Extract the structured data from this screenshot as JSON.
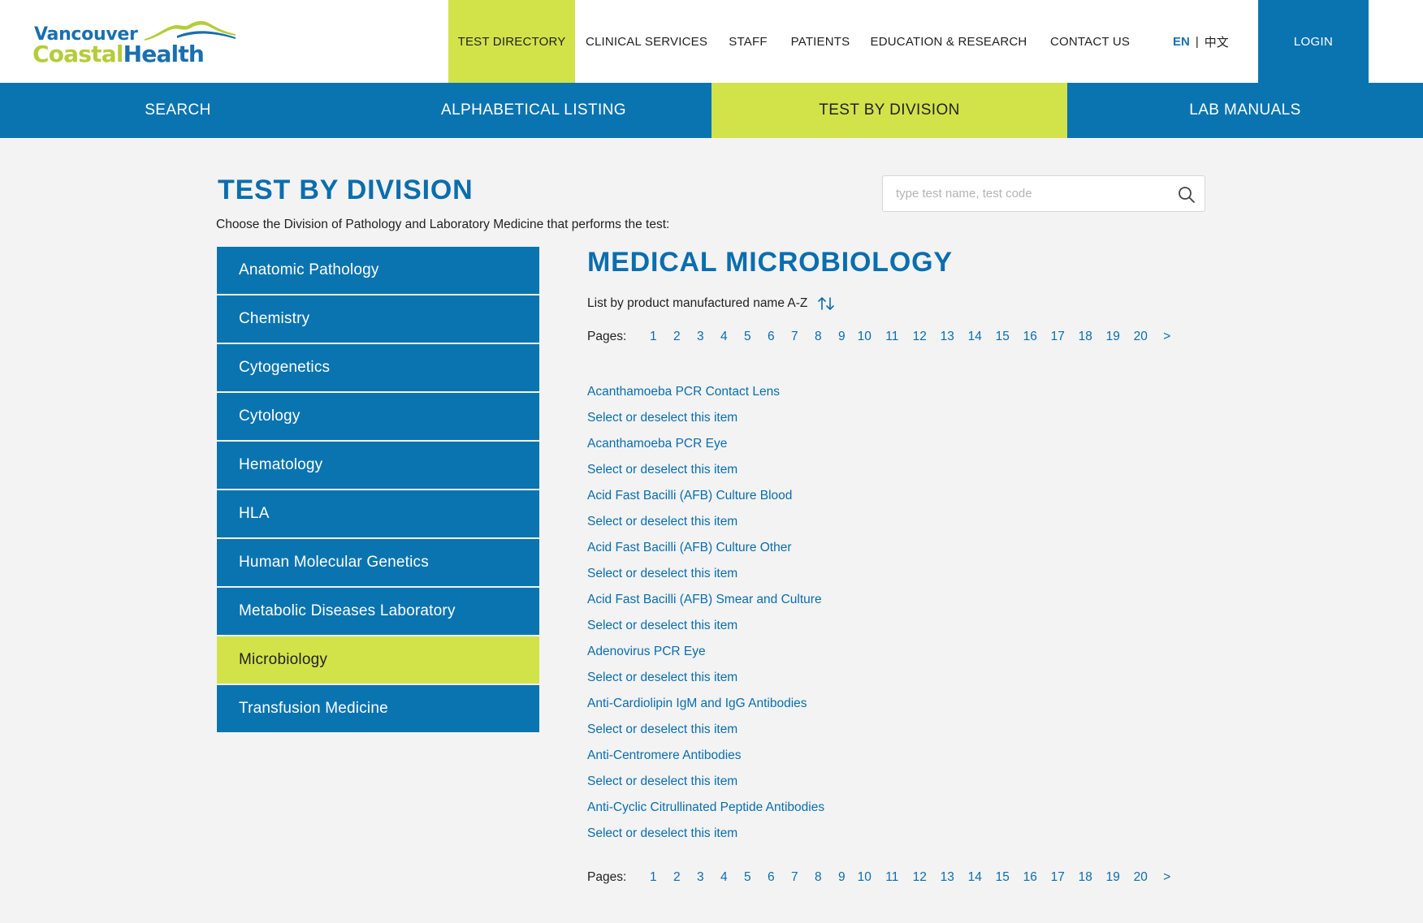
{
  "brand": {
    "line1": "Vancouver",
    "line2_a": "Coastal",
    "line2_b": "Health",
    "colors": {
      "blue": "#0a74b0",
      "lime": "#d2e34a",
      "background": "#f3f3f3"
    }
  },
  "top_nav": {
    "items": [
      {
        "label": "TEST DIRECTORY",
        "active": true
      },
      {
        "label": "CLINICAL SERVICES",
        "active": false
      },
      {
        "label": "STAFF",
        "active": false
      },
      {
        "label": "PATIENTS",
        "active": false
      },
      {
        "label": "EDUCATION & RESEARCH",
        "active": false
      },
      {
        "label": "CONTACT US",
        "active": false
      }
    ],
    "lang_en": "EN",
    "lang_sep": "|",
    "lang_zh": "中文",
    "login": "LOGIN"
  },
  "sub_nav": {
    "items": [
      {
        "label": "SEARCH",
        "active": false
      },
      {
        "label": "ALPHABETICAL LISTING",
        "active": false
      },
      {
        "label": "TEST BY DIVISION",
        "active": true
      },
      {
        "label": "LAB MANUALS",
        "active": false
      }
    ]
  },
  "page": {
    "title": "TEST BY DIVISION",
    "subtitle": "Choose the Division of Pathology and Laboratory Medicine that performs the test:",
    "search_placeholder": "type test name, test code",
    "search_icon": "magnifier-icon"
  },
  "divisions": [
    {
      "label": "Anatomic Pathology",
      "active": false
    },
    {
      "label": "Chemistry",
      "active": false
    },
    {
      "label": "Cytogenetics",
      "active": false
    },
    {
      "label": "Cytology",
      "active": false
    },
    {
      "label": "Hematology",
      "active": false
    },
    {
      "label": "HLA",
      "active": false
    },
    {
      "label": "Human Molecular Genetics",
      "active": false
    },
    {
      "label": "Metabolic Diseases Laboratory",
      "active": false
    },
    {
      "label": "Microbiology",
      "active": true
    },
    {
      "label": "Transfusion Medicine",
      "active": false
    }
  ],
  "content": {
    "section_title": "MEDICAL MICROBIOLOGY",
    "sort_label": "List by product manufactured name A-Z",
    "sort_icon": "sort-arrows-icon",
    "pages_label": "Pages:",
    "pages": [
      "1",
      "2",
      "3",
      "4",
      "5",
      "6",
      "7",
      "8",
      "9",
      "10",
      "11",
      "12",
      "13",
      "14",
      "15",
      "16",
      "17",
      "18",
      "19",
      "20"
    ],
    "next_page": ">",
    "results": [
      "Acanthamoeba PCR Contact Lens",
      "Select or deselect this item",
      "Acanthamoeba PCR Eye",
      "Select or deselect this item",
      "Acid Fast Bacilli (AFB) Culture Blood",
      "Select or deselect this item",
      "Acid Fast Bacilli (AFB) Culture Other",
      "Select or deselect this item",
      "Acid Fast Bacilli (AFB) Smear and Culture",
      "Select or deselect this item",
      "Adenovirus PCR Eye",
      "Select or deselect this item",
      "Anti-Cardiolipin IgM and IgG Antibodies",
      "Select or deselect this item",
      "Anti-Centromere Antibodies",
      "Select or deselect this item",
      "Anti-Cyclic Citrullinated Peptide Antibodies",
      "Select or deselect this item"
    ]
  }
}
